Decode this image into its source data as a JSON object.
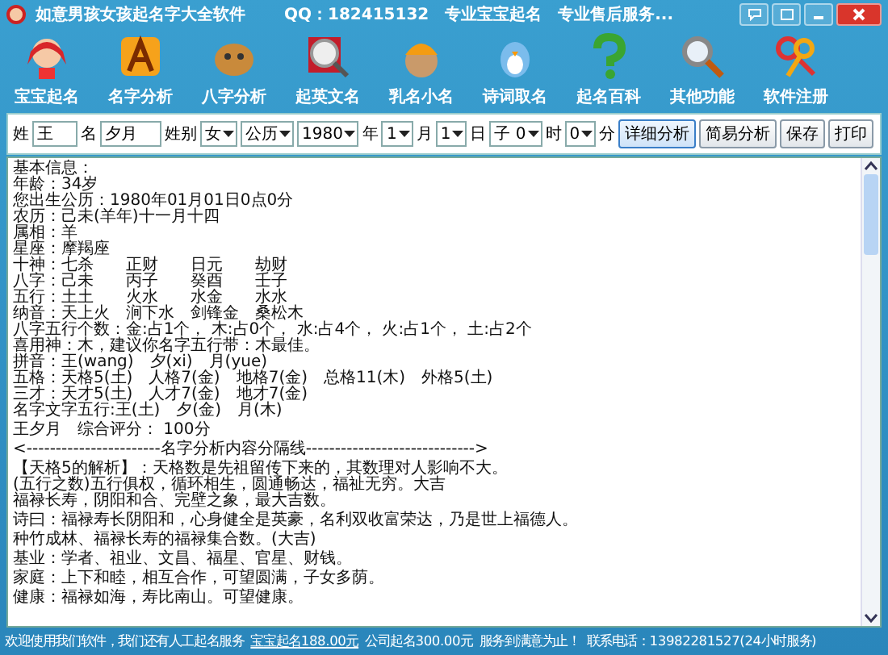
{
  "window": {
    "title": "如意男孩女孩起名字大全软件",
    "subtitle": "QQ：182415132　专业宝宝起名　专业售后服务..."
  },
  "toolbar": [
    {
      "label": "宝宝起名"
    },
    {
      "label": "名字分析"
    },
    {
      "label": "八字分析"
    },
    {
      "label": "起英文名"
    },
    {
      "label": "乳名小名"
    },
    {
      "label": "诗词取名"
    },
    {
      "label": "起名百科"
    },
    {
      "label": "其他功能"
    },
    {
      "label": "软件注册"
    }
  ],
  "form": {
    "fields": [
      {
        "kind": "label",
        "text": "姓"
      },
      {
        "kind": "input",
        "value": "王"
      },
      {
        "kind": "label",
        "text": "名"
      },
      {
        "kind": "input",
        "value": "夕月"
      },
      {
        "kind": "label",
        "text": "姓别"
      },
      {
        "kind": "select",
        "value": "女"
      },
      {
        "kind": "select",
        "value": "公历"
      },
      {
        "kind": "select",
        "value": "1980"
      },
      {
        "kind": "label",
        "text": "年"
      },
      {
        "kind": "select",
        "value": "1"
      },
      {
        "kind": "label",
        "text": "月"
      },
      {
        "kind": "select",
        "value": "1"
      },
      {
        "kind": "label",
        "text": "日"
      },
      {
        "kind": "select",
        "value": "子 0"
      },
      {
        "kind": "label",
        "text": "时"
      },
      {
        "kind": "select",
        "value": "0"
      },
      {
        "kind": "label",
        "text": "分"
      }
    ],
    "buttons": [
      {
        "label": "详细分析",
        "selected": true
      },
      {
        "label": "简易分析",
        "selected": false
      },
      {
        "label": "保存",
        "selected": false
      },
      {
        "label": "打印",
        "selected": false
      }
    ]
  },
  "result": {
    "blocks": [
      {
        "lines": [
          "基本信息：",
          "年龄：34岁",
          "您出生公历：1980年01月01日0点0分",
          "农历：己未(羊年)十一月十四",
          "属相：羊",
          "星座：摩羯座",
          "十神：七杀　　正财　　日元　　劫财",
          "八字：己未　　丙子　　癸酉　　壬子",
          "五行：土土　　火水　　水金　　水水",
          "纳音：天上火　涧下水　剑锋金　桑松木",
          "八字五行个数：金:占1个， 木:占0个， 水:占4个， 火:占1个， 土:占2个",
          "喜用神：木，建议你名字五行带：木最佳。",
          "拼音：王(wang)　夕(xi)　月(yue)",
          "五格：天格5(土)　人格7(金)　地格7(金)　总格11(木)　外格5(土)",
          "三才：天才5(土)　人才7(金)　地才7(金)",
          "名字文字五行:王(土)　夕(金)　月(木)"
        ]
      },
      {
        "lines": [
          "王夕月　综合评分： 100分"
        ]
      },
      {
        "lines": [
          "<-----------------------名字分析内容分隔线----------------------------->"
        ]
      },
      {
        "lines": [
          "【天格5的解析】：天格数是先祖留传下来的，其数理对人影响不大。",
          "(五行之数)五行俱权，循环相生，圆通畅达，福祉无穷。大吉",
          "福禄长寿，阴阳和合、完壁之象，最大吉数。"
        ]
      },
      {
        "lines": [
          "诗曰：福禄寿长阴阳和，心身健全是英豪，名利双收富荣达，乃是世上福德人。"
        ]
      },
      {
        "lines": [
          "种竹成林、福禄长寿的福禄集合数。(大吉)"
        ]
      },
      {
        "lines": [
          "基业：学者、祖业、文昌、福星、官星、财钱。"
        ]
      },
      {
        "lines": [
          "家庭：上下和睦，相互合作，可望圆满，子女多荫。"
        ]
      },
      {
        "lines": [
          "健康：福禄如海，寿比南山。可望健康。"
        ]
      }
    ]
  },
  "status_bar": [
    {
      "text": "欢迎使用我们软件，我们还有人工起名服务",
      "underlined": false
    },
    {
      "text": "宝宝起名188.00元",
      "underlined": true
    },
    {
      "text": "公司起名300.00元",
      "underlined": false
    },
    {
      "text": "服务到满意为止！",
      "underlined": false
    },
    {
      "text": "联系电话：13982281527(24小时服务)",
      "underlined": false
    }
  ]
}
